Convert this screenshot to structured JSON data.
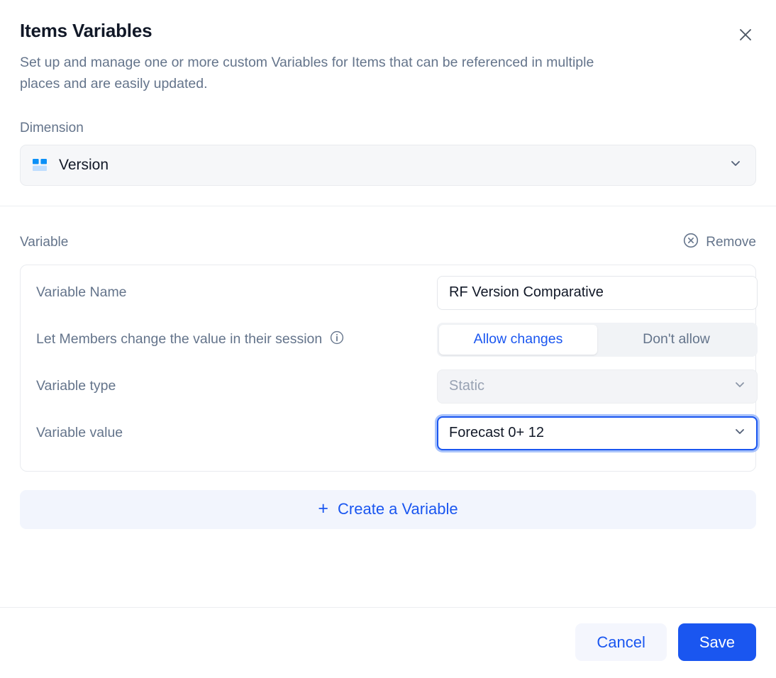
{
  "header": {
    "title": "Items Variables",
    "subtitle": "Set up and manage one or more custom Variables for Items that can be referenced in multiple places and are easily updated.",
    "close_icon": "close-icon"
  },
  "dimension": {
    "label": "Dimension",
    "value": "Version",
    "icon": "dimension-grid-icon",
    "chevron_icon": "chevron-down-icon"
  },
  "variable": {
    "section_label": "Variable",
    "remove_label": "Remove",
    "remove_icon": "circle-x-icon",
    "rows": {
      "name": {
        "label": "Variable Name",
        "value": "RF Version Comparative",
        "placeholder": "Variable Name"
      },
      "allow_changes": {
        "label": "Let Members change the value in their session",
        "info_icon": "info-circle-icon",
        "options": [
          "Allow changes",
          "Don't allow"
        ],
        "selected": "Allow changes"
      },
      "type": {
        "label": "Variable type",
        "value": "Static",
        "chevron_icon": "chevron-down-icon"
      },
      "value": {
        "label": "Variable value",
        "value": "Forecast 0+ 12",
        "chevron_icon": "chevron-down-icon"
      }
    }
  },
  "create": {
    "label": "Create a Variable",
    "plus": "+"
  },
  "footer": {
    "cancel_label": "Cancel",
    "save_label": "Save"
  },
  "colors": {
    "accent_blue": "#1a56f0",
    "icon_blue": "#0b90f7",
    "icon_blue_light": "#bfdeff",
    "muted_text": "#64748b",
    "create_bg": "#f2f5fd"
  }
}
